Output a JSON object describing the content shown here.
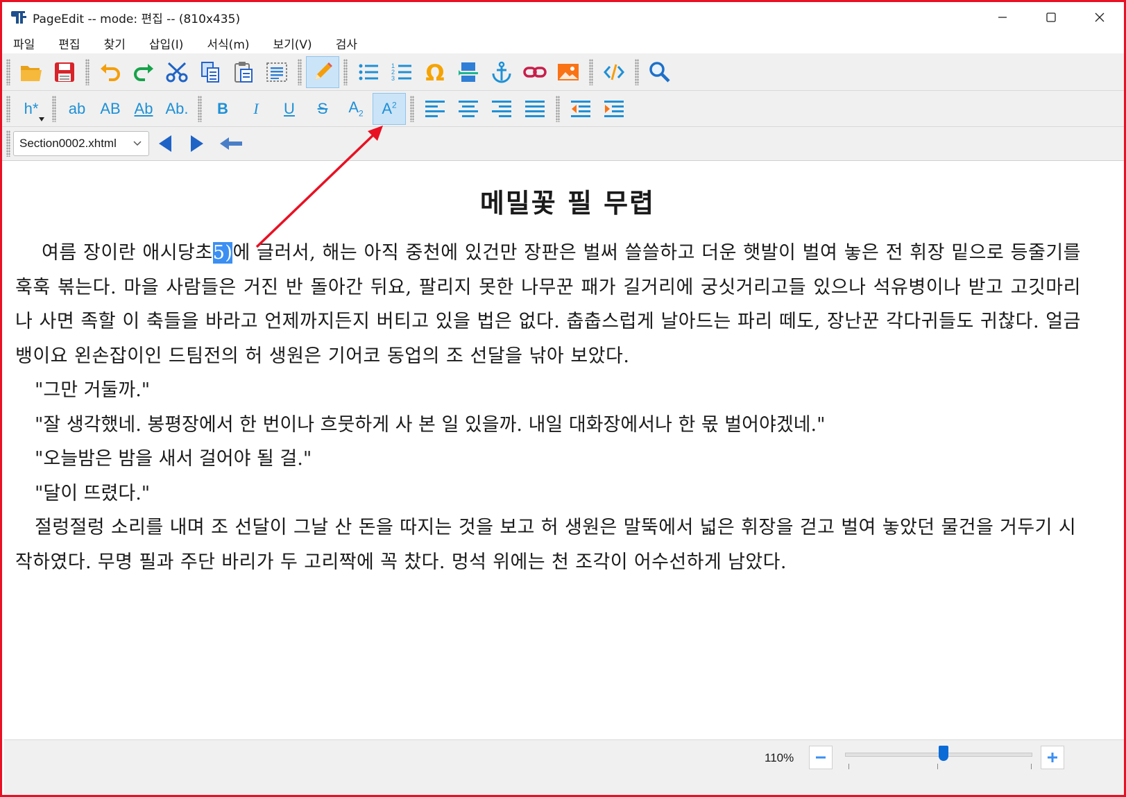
{
  "window": {
    "title": "PageEdit -- mode: 편집 -- (810x435)",
    "minimize_icon": "minimize-icon",
    "maximize_icon": "maximize-icon",
    "close_icon": "close-icon"
  },
  "menu": {
    "items": [
      "파일",
      "편집",
      "찾기",
      "삽입(I)",
      "서식(m)",
      "보기(V)",
      "검사"
    ]
  },
  "toolbar_main": {
    "buttons": [
      "open-folder-icon",
      "save-icon",
      "undo-icon",
      "redo-icon",
      "cut-icon",
      "copy-icon",
      "paste-icon",
      "select-all-icon",
      "edit-pencil-icon",
      "bullet-list-icon",
      "numbered-list-icon",
      "omega-special-char-icon",
      "insert-file-icon",
      "anchor-icon",
      "link-icon",
      "insert-image-icon",
      "code-view-icon",
      "search-icon"
    ]
  },
  "toolbar_format": {
    "heading_label": "h*",
    "case_lower": "ab",
    "case_upper": "AB",
    "case_title": "Ab",
    "case_sentence": "Ab.",
    "bold": "B",
    "italic": "I",
    "underline": "U",
    "strike": "S",
    "subscript_base": "A",
    "subscript_sub": "2",
    "superscript_base": "A",
    "superscript_sup": "2"
  },
  "nav": {
    "file_selected": "Section0002.xhtml"
  },
  "document": {
    "title": "메밀꽃 필 무렵",
    "p1_before": "여름 장이란 애시당초",
    "p1_selected": "5)",
    "p1_after": "에 글러서, 해는 아직 중천에 있건만 장판은 벌써 쓸쓸하고 더운 햇발이 벌여 놓은 전 휘장 밑으로 등줄기를 훅훅 볶는다. 마을 사람들은 거진 반 돌아간 뒤요, 팔리지 못한 나무꾼 패가 길거리에 궁싯거리고들 있으나 석유병이나 받고 고깃마리나 사면 족할 이 축들을 바라고 언제까지든지 버티고 있을 법은 없다. 춥춥스럽게 날아드는 파리 떼도, 장난꾼 각다귀들도 귀찮다. 얼금뱅이요 왼손잡이인 드팀전의 허 생원은 기어코 동업의 조 선달을 낚아 보았다.",
    "quote1": "\"그만 거둘까.\"",
    "quote2": "\"잘 생각했네. 봉평장에서 한 번이나 흐뭇하게 사 본 일 있을까. 내일 대화장에서나 한 몫 벌어야겠네.\"",
    "quote3": "\"오늘밤은 밤을 새서 걸어야 될 걸.\"",
    "quote4": "\"달이 뜨렸다.\"",
    "p_last": "절렁절렁 소리를 내며 조 선달이 그날 산 돈을 따지는 것을 보고 허 생원은 말뚝에서 넓은 휘장을 걷고 벌여 놓았던 물건을 거두기 시작하였다. 무명 필과 주단 바리가 두 고리짝에 꼭 찼다. 멍석 위에는 천 조각이 어수선하게 남았다."
  },
  "status": {
    "zoom": "110%",
    "zoom_value_percent": 110
  },
  "colors": {
    "accent": "#1e90d6",
    "selection": "#3b8ff2",
    "annotation_arrow": "#e81123",
    "window_border": "#e81123"
  }
}
